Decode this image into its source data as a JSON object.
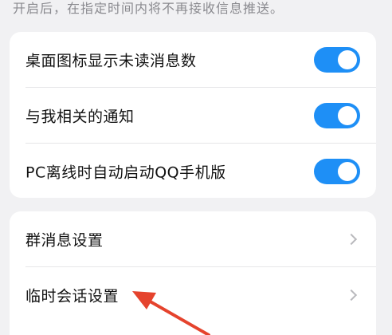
{
  "hint_text": "开启后，在指定时间内将不再接收信息推送。",
  "toggles": [
    {
      "label": "桌面图标显示未读消息数",
      "on": true
    },
    {
      "label": "与我相关的通知",
      "on": true
    },
    {
      "label": "PC离线时自动启动QQ手机版",
      "on": true
    }
  ],
  "settings": [
    {
      "label": "群消息设置"
    },
    {
      "label": "临时会话设置"
    }
  ],
  "colors": {
    "toggle_on": "#1e8ff6",
    "annotation_arrow": "#e5432d"
  },
  "icons": {
    "chevron": "chevron-right-icon",
    "annotation": "red-arrow-annotation"
  }
}
